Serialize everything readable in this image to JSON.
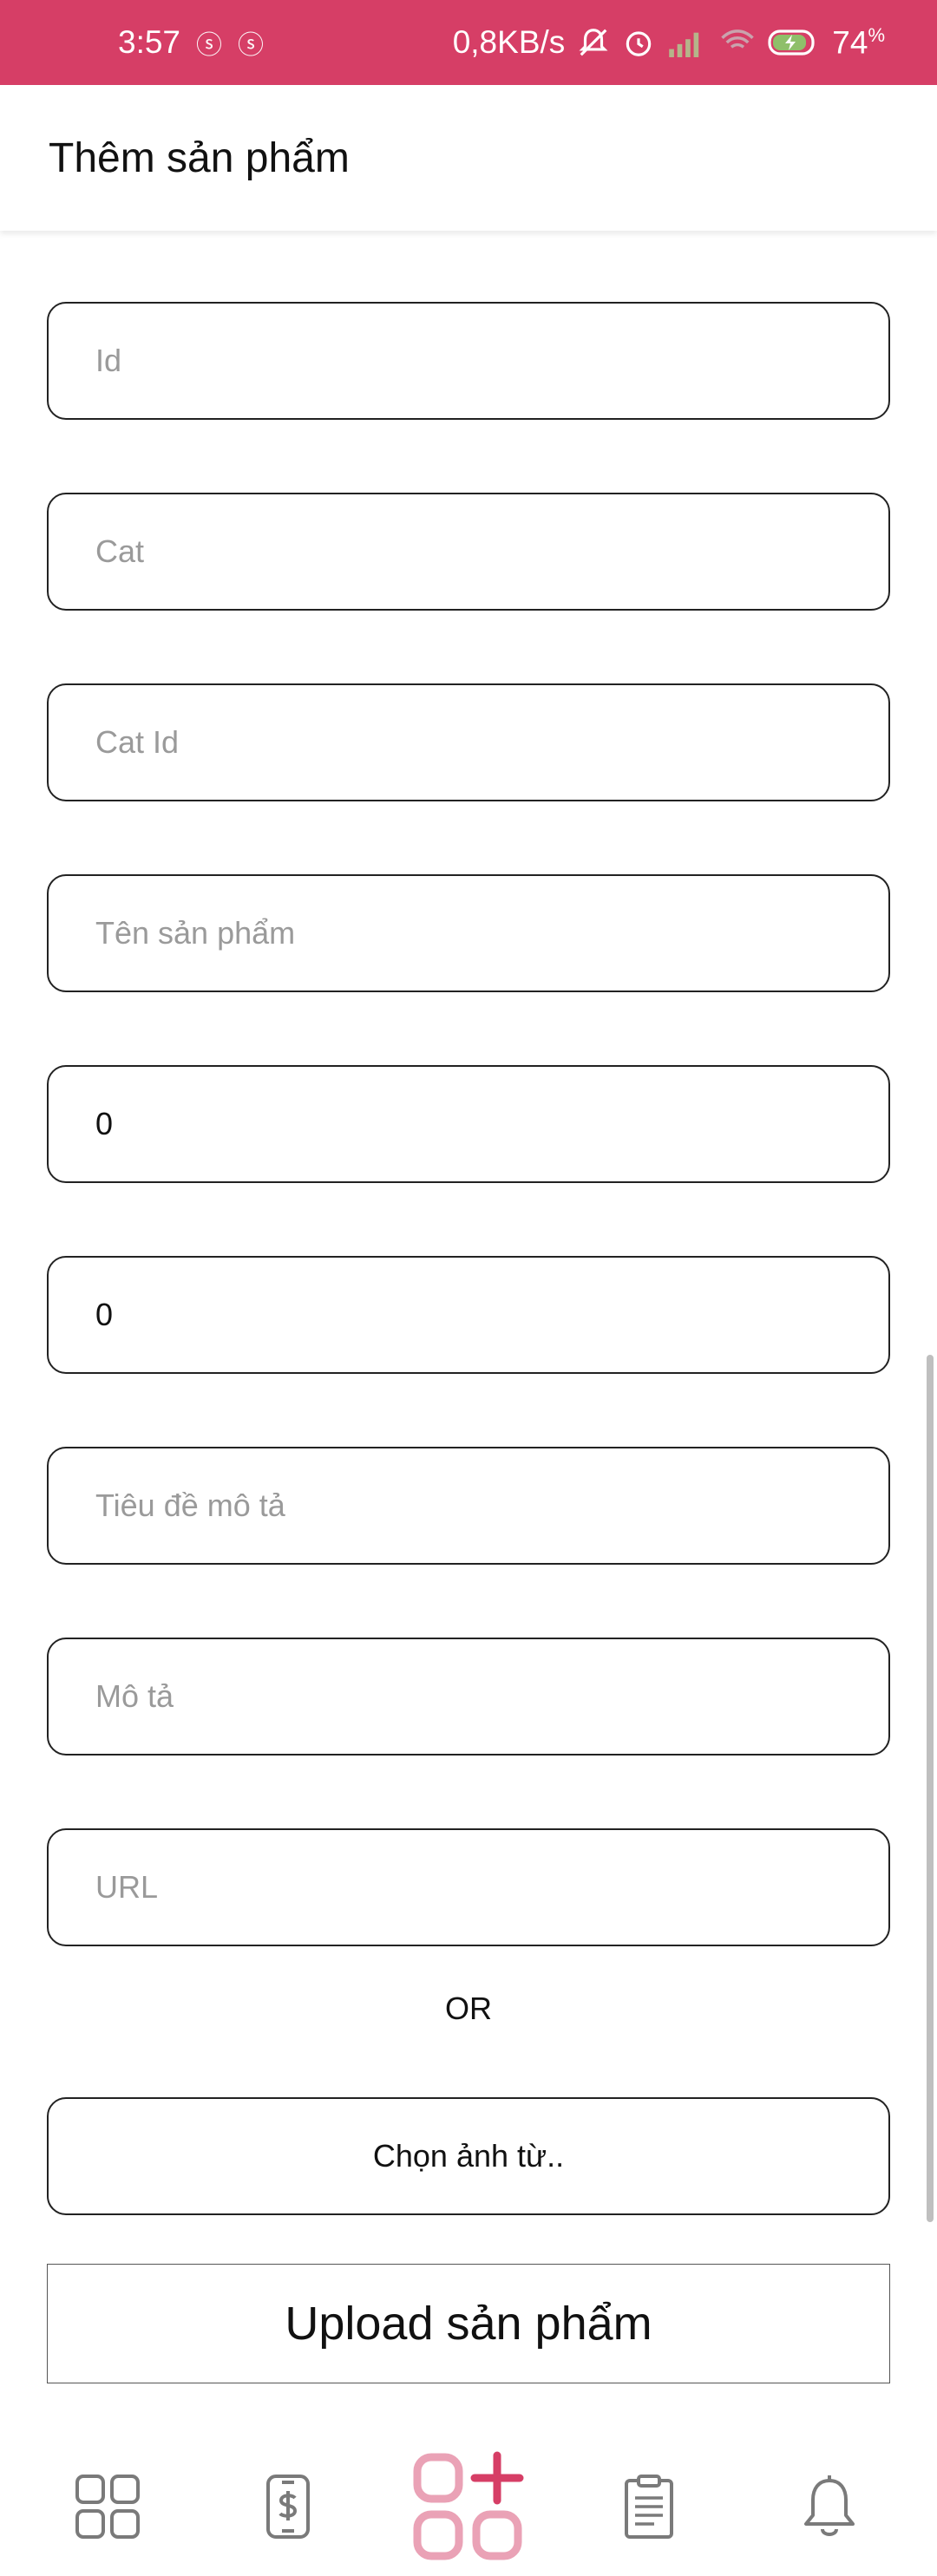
{
  "status_bar": {
    "time": "3:57",
    "network_speed": "0,8KB/s",
    "battery": "74",
    "battery_unit": "%"
  },
  "app_bar": {
    "title": "Thêm sản phẩm"
  },
  "form": {
    "fields": [
      {
        "name": "id",
        "placeholder": "Id",
        "value": ""
      },
      {
        "name": "cat",
        "placeholder": "Cat",
        "value": ""
      },
      {
        "name": "cat-id",
        "placeholder": "Cat Id",
        "value": ""
      },
      {
        "name": "product-name",
        "placeholder": "Tên sản phẩm",
        "value": ""
      },
      {
        "name": "number-1",
        "placeholder": "",
        "value": "0"
      },
      {
        "name": "number-2",
        "placeholder": "",
        "value": "0"
      },
      {
        "name": "description-title",
        "placeholder": "Tiêu đề mô tả",
        "value": ""
      },
      {
        "name": "description",
        "placeholder": "Mô tả",
        "value": ""
      },
      {
        "name": "url",
        "placeholder": "URL",
        "value": ""
      }
    ],
    "or_label": "OR",
    "choose_image_label": "Chọn ảnh từ..",
    "upload_label": "Upload sản phẩm"
  },
  "bottom_nav": {
    "items": [
      {
        "icon": "grid-icon"
      },
      {
        "icon": "phone-dollar-icon"
      },
      {
        "icon": "add-product-icon",
        "active": true
      },
      {
        "icon": "clipboard-icon"
      },
      {
        "icon": "bell-icon"
      }
    ]
  },
  "colors": {
    "status_bar": "#d63e66",
    "accent": "#d63e66",
    "accent_light": "#eaa2b6",
    "icon_gray": "#7a7a7a"
  }
}
